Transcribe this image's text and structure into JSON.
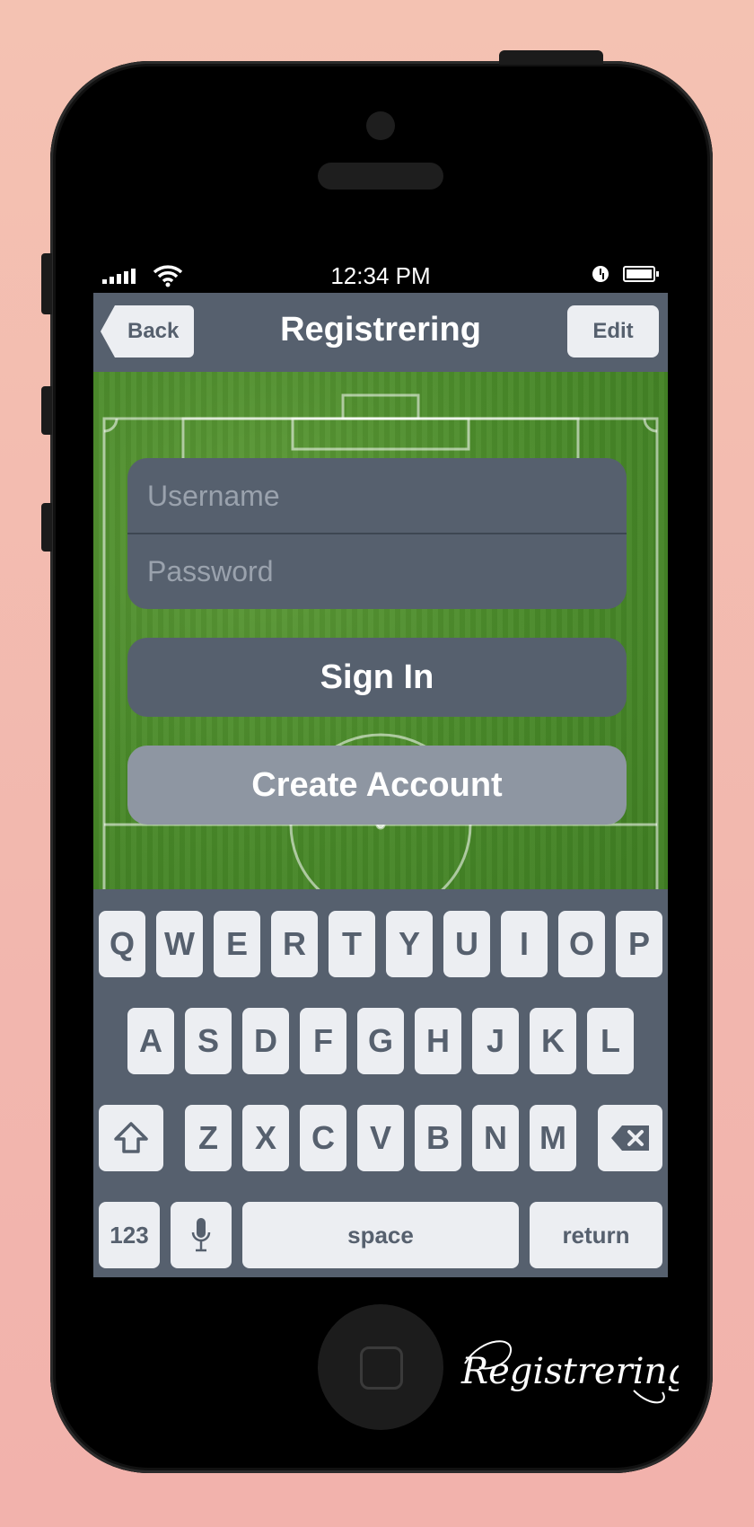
{
  "status_bar": {
    "time": "12:34 PM"
  },
  "nav": {
    "back_label": "Back",
    "title": "Registrering",
    "edit_label": "Edit"
  },
  "form": {
    "username_placeholder": "Username",
    "password_placeholder": "Password",
    "sign_in_label": "Sign In",
    "create_account_label": "Create Account"
  },
  "keyboard": {
    "row1": [
      "Q",
      "W",
      "E",
      "R",
      "T",
      "Y",
      "U",
      "I",
      "O",
      "P"
    ],
    "row2": [
      "A",
      "S",
      "D",
      "F",
      "G",
      "H",
      "J",
      "K",
      "L"
    ],
    "row3": [
      "Z",
      "X",
      "C",
      "V",
      "B",
      "N",
      "M"
    ],
    "numbers_label": "123",
    "space_label": "space",
    "return_label": "return"
  },
  "signature": "Registrering",
  "colors": {
    "bar": "#56606e",
    "key": "#eceef2",
    "accent_light": "#8e96a2",
    "background": "#f3bdb1"
  },
  "icons": [
    "signal-icon",
    "wifi-icon",
    "clock-icon",
    "battery-icon",
    "shift-icon",
    "backspace-icon",
    "microphone-icon",
    "home-button-icon"
  ]
}
